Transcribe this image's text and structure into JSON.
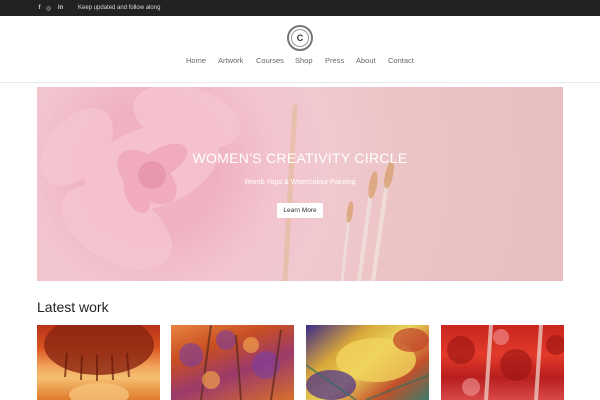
{
  "topbar": {
    "social": [
      {
        "icon": "facebook-icon",
        "glyph": "f"
      },
      {
        "icon": "instagram-icon",
        "glyph": "◎"
      },
      {
        "icon": "linkedin-icon",
        "glyph": "in"
      }
    ],
    "tagline": "Keep updated and follow along"
  },
  "header": {
    "logo_letter": "C"
  },
  "nav": {
    "items": [
      "Home",
      "Artwork",
      "Courses",
      "Shop",
      "Press",
      "About",
      "Contact"
    ]
  },
  "hero": {
    "title": "WOMEN'S CREATIVITY CIRCLE",
    "subtitle": "Womb Yoga & Watercolour Painting",
    "button_label": "Learn More"
  },
  "latest": {
    "title": "Latest work"
  },
  "colors": {
    "topbar": "#222222",
    "hero_pink": "#efb0c1",
    "text_dark": "#222222"
  }
}
